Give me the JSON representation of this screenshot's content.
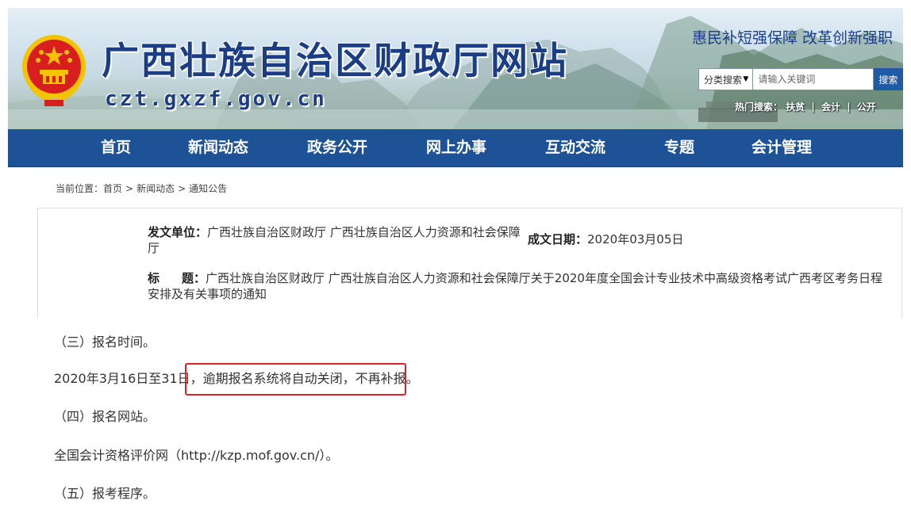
{
  "header": {
    "site_title": "广西壮族自治区财政厅网站",
    "site_domain": "czt.gxzf.gov.cn",
    "slogan": "惠民补短强保障 改革创新强职",
    "search": {
      "category_label": "分类搜索",
      "placeholder": "请输入关键词",
      "button_label": "搜索"
    },
    "hot_search": {
      "label": "热门搜索：",
      "terms": [
        "扶贫",
        "会计",
        "公开"
      ],
      "separator": "|"
    }
  },
  "nav": {
    "items": [
      "首页",
      "新闻动态",
      "政务公开",
      "网上办事",
      "互动交流",
      "专题",
      "会计管理"
    ]
  },
  "breadcrumb": {
    "label": "当前位置：",
    "items": [
      "首页",
      "新闻动态",
      "通知公告"
    ],
    "separator": ">"
  },
  "document_info": {
    "unit_label": "发文单位：",
    "unit_value": "广西壮族自治区财政厅  广西壮族自治区人力资源和社会保障厅",
    "date_label": "成文日期：",
    "date_value": "2020年03月05日",
    "title_label_1": "标",
    "title_label_2": "题：",
    "title_value": "广西壮族自治区财政厅    广西壮族自治区人力资源和社会保障厅关于2020年度全国会计专业技术中高级资格考试广西考区考务日程安排及有关事项的通知"
  },
  "body": {
    "section_3_heading": "（三）报名时间。",
    "reg_time_prefix": "2020年3月16日至31日，",
    "reg_time_highlight": "逾期报名系统将自动关闭，不再补报。",
    "section_4_heading": "（四）报名网站。",
    "website_line": "全国会计资格评价网（http://kzp.mof.gov.cn/）。",
    "section_5_heading": "（五）报考程序。"
  },
  "colors": {
    "nav_bg": "#1d5296",
    "title_blue": "#1b3d86",
    "highlight_border": "#d9232b",
    "emblem_red": "#d81e1e",
    "emblem_gold": "#f5c400"
  }
}
